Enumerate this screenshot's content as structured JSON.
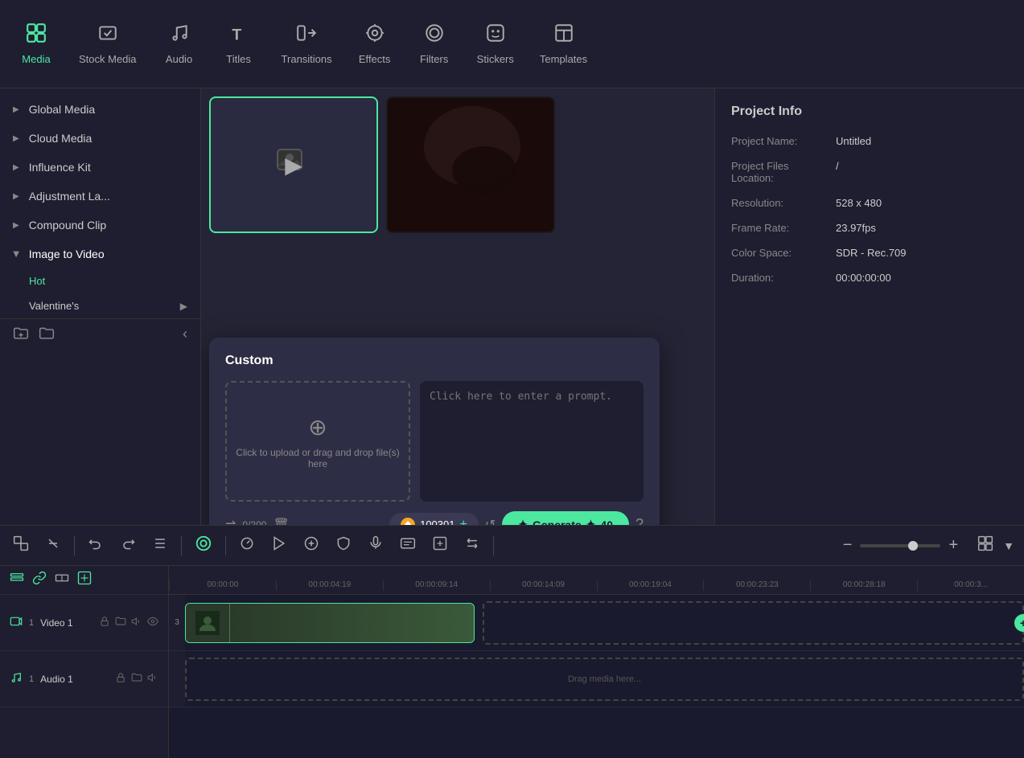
{
  "nav": {
    "items": [
      {
        "id": "media",
        "label": "Media",
        "icon": "⬛",
        "active": true
      },
      {
        "id": "stock_media",
        "label": "Stock Media",
        "icon": "🖼"
      },
      {
        "id": "audio",
        "label": "Audio",
        "icon": "♪"
      },
      {
        "id": "titles",
        "label": "Titles",
        "icon": "T"
      },
      {
        "id": "transitions",
        "label": "Transitions",
        "icon": "⬡"
      },
      {
        "id": "effects",
        "label": "Effects",
        "icon": "✳"
      },
      {
        "id": "filters",
        "label": "Filters",
        "icon": "⊙"
      },
      {
        "id": "stickers",
        "label": "Stickers",
        "icon": "😊"
      },
      {
        "id": "templates",
        "label": "Templates",
        "icon": "⬜"
      }
    ]
  },
  "sidebar": {
    "items": [
      {
        "id": "global_media",
        "label": "Global Media",
        "expanded": false
      },
      {
        "id": "cloud_media",
        "label": "Cloud Media",
        "expanded": false
      },
      {
        "id": "influence_kit",
        "label": "Influence Kit",
        "expanded": false
      },
      {
        "id": "adjustment_la",
        "label": "Adjustment La...",
        "expanded": false
      },
      {
        "id": "compound_clip",
        "label": "Compound Clip",
        "expanded": false
      },
      {
        "id": "image_to_video",
        "label": "Image to Video",
        "expanded": true
      }
    ],
    "sub_items": [
      {
        "label": "Hot"
      },
      {
        "label": "Valentine's"
      }
    ],
    "tools": [
      {
        "id": "add_folder",
        "icon": "📁+"
      },
      {
        "id": "folder_up",
        "icon": "📂"
      }
    ],
    "collapse_icon": "‹"
  },
  "custom_modal": {
    "title": "Custom",
    "upload_text": "Click to upload or drag and drop file(s) here",
    "prompt_placeholder": "Click here to enter a prompt.",
    "char_count": "0/200",
    "credits": "100301",
    "generate_label": "Generate",
    "generate_credits": "40",
    "shuffle_icon": "⇌",
    "delete_icon": "🗑",
    "refresh_icon": "↺",
    "help_icon": "?"
  },
  "project_info": {
    "title": "Project Info",
    "fields": [
      {
        "label": "Project Name:",
        "value": "Untitled"
      },
      {
        "label": "Project Files Location:",
        "value": "/"
      },
      {
        "label": "Resolution:",
        "value": "528 x 480"
      },
      {
        "label": "Frame Rate:",
        "value": "23.97fps"
      },
      {
        "label": "Color Space:",
        "value": "SDR - Rec.709"
      },
      {
        "label": "Duration:",
        "value": "00:00:00:00"
      }
    ]
  },
  "timeline": {
    "toolbar": {
      "icons": [
        "⬛⬛",
        "↖",
        "|",
        "↩",
        "↪",
        "»",
        "|",
        "🕐",
        "|",
        "◎",
        "▶",
        "⊕",
        "⛉",
        "🎤",
        "≡",
        "↔",
        "↕",
        "|"
      ]
    },
    "ruler_marks": [
      "00:00:00",
      "00:00:04:19",
      "00:00:09:14",
      "00:00:14:09",
      "00:00:19:04",
      "00:00:23:23",
      "00:00:28:18",
      "00:00:3..."
    ],
    "tracks": [
      {
        "id": "video1",
        "icon": "📹",
        "label": "Video 1",
        "tools": [
          "📹",
          "📂",
          "🔊",
          "👁"
        ]
      },
      {
        "id": "audio1",
        "icon": "🎵",
        "label": "Audio 1",
        "tools": [
          "🎵",
          "📂",
          "🔊"
        ]
      }
    ],
    "track_header_tools": [
      "⊕",
      "⛓",
      "⇄",
      "⧉"
    ]
  }
}
